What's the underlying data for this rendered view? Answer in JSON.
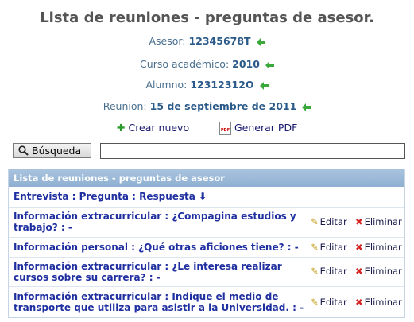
{
  "page": {
    "title": "Lista de reuniones - preguntas de asesor."
  },
  "meta": [
    {
      "label": "Asesor:",
      "value": "12345678T"
    },
    {
      "label": "Curso académico:",
      "value": "2010"
    },
    {
      "label": "Alumno:",
      "value": "12312312O"
    },
    {
      "label": "Reunion:",
      "value": "15 de septiembre de 2011"
    }
  ],
  "actions": {
    "create": "Crear nuevo",
    "pdf": "Generar PDF",
    "pdf_icon_text": "PDF"
  },
  "search": {
    "button": "Búsqueda",
    "value": "",
    "placeholder": ""
  },
  "grid": {
    "caption": "Lista de reuniones - preguntas de asesor",
    "sort_header": "Entrevista : Pregunta : Respuesta",
    "sort_arrow": "⬇",
    "edit_label": "Editar",
    "delete_label": "Eliminar",
    "rows": [
      {
        "line1": "Información extracurricular : ¿Compagina estudios y",
        "line2": "trabajo? : -"
      },
      {
        "line1": "Información personal : ¿Qué otras aficiones tiene? : -",
        "line2": ""
      },
      {
        "line1": "Información extracurricular : ¿Le interesa realizar",
        "line2": "cursos sobre su carrera? : -"
      },
      {
        "line1": "Información extracurricular : Indique el medio de",
        "line2": "transporte que utiliza para asistir a la Universidad. : -"
      }
    ]
  },
  "colors": {
    "accent": "#2a5a8a",
    "link": "#1f2fa0",
    "header_bg": "#9ab8d8",
    "arrow": "#3aa83a",
    "delete": "#d62020"
  },
  "icons": {
    "back": "arrow-left-icon",
    "create": "plus-icon",
    "pdf": "pdf-icon",
    "search": "magnifier-icon",
    "edit": "pencil-icon",
    "delete": "x-icon"
  }
}
